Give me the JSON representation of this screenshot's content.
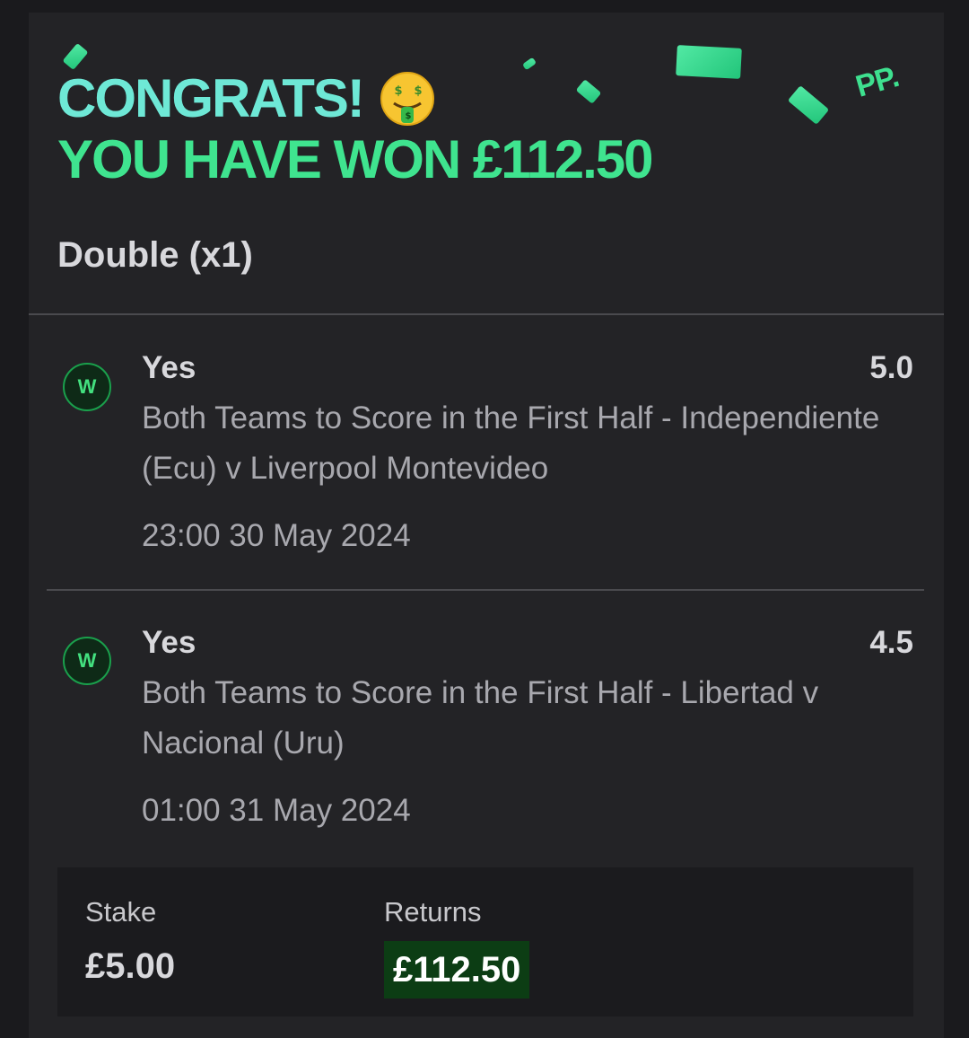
{
  "header": {
    "line1": "CONGRATS!",
    "line2": "YOU HAVE WON £112.50",
    "logo": "PP."
  },
  "bet_type": "Double (x1)",
  "selections": [
    {
      "status": "W",
      "name": "Yes",
      "odds": "5.0",
      "market": "Both Teams to Score in the First Half - Independiente (Ecu) v Liverpool Montevideo",
      "time": "23:00 30 May 2024"
    },
    {
      "status": "W",
      "name": "Yes",
      "odds": "4.5",
      "market": "Both Teams to Score in the First Half - Libertad v Nacional (Uru)",
      "time": "01:00 31 May 2024"
    }
  ],
  "summary": {
    "stake_label": "Stake",
    "stake_value": "£5.00",
    "returns_label": "Returns",
    "returns_value": "£112.50"
  },
  "icons": {
    "emoji": "money-mouth-face-icon",
    "confetti": "money-note-icon"
  },
  "colors": {
    "headline_primary": "#6ee8d6",
    "headline_secondary": "#3fe48f",
    "win_badge": "#43e07f",
    "returns_highlight": "#0c3d14"
  }
}
